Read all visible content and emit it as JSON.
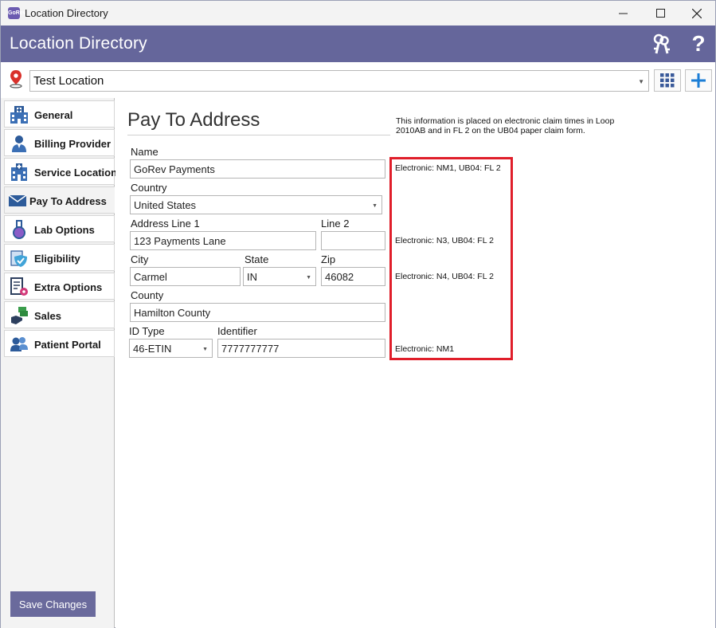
{
  "window": {
    "title": "Location Directory",
    "app_icon_text": "GoRev"
  },
  "header": {
    "title": "Location Directory",
    "help_label": "?"
  },
  "location_selector": {
    "value": "Test Location"
  },
  "sidebar": {
    "items": [
      {
        "label": "General",
        "icon": "hospital-icon"
      },
      {
        "label": "Billing Provider",
        "icon": "doctor-icon"
      },
      {
        "label": "Service Location",
        "icon": "building-icon"
      },
      {
        "label": "Pay To Address",
        "icon": "envelope-icon",
        "active": true
      },
      {
        "label": "Lab Options",
        "icon": "flask-icon"
      },
      {
        "label": "Eligibility",
        "icon": "shield-check-icon"
      },
      {
        "label": "Extra Options",
        "icon": "document-gear-icon"
      },
      {
        "label": "Sales",
        "icon": "money-hand-icon"
      },
      {
        "label": "Patient Portal",
        "icon": "users-icon"
      }
    ],
    "save_label": "Save Changes"
  },
  "main": {
    "section_title": "Pay To Address",
    "info_text": "This information is placed on electronic claim times in Loop 2010AB and in FL 2 on the UB04 paper claim form.",
    "labels": {
      "name": "Name",
      "country": "Country",
      "address1": "Address Line 1",
      "line2": "Line 2",
      "city": "City",
      "state": "State",
      "zip": "Zip",
      "county": "County",
      "id_type": "ID Type",
      "identifier": "Identifier"
    },
    "values": {
      "name": "GoRev Payments",
      "country": "United States",
      "address1": "123 Payments Lane",
      "line2": "",
      "city": "Carmel",
      "state": "IN",
      "zip": "46082",
      "county": "Hamilton County",
      "id_type": "46-ETIN",
      "identifier": "7777777777"
    },
    "hints": {
      "name": "Electronic: NM1, UB04: FL 2",
      "address": "Electronic: N3, UB04: FL 2",
      "city": "Electronic: N4, UB04: FL 2",
      "id": "Electronic: NM1"
    }
  },
  "colors": {
    "header_bg": "#65669b",
    "highlight": "#e01e2a",
    "accent_blue": "#1c7ed6",
    "save_bg": "#6a6a9c"
  }
}
